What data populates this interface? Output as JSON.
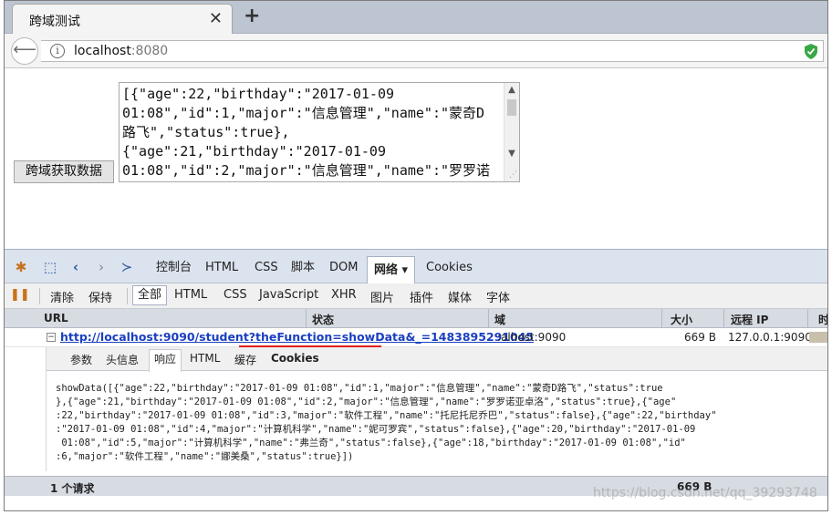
{
  "tab": {
    "title": "跨域测试"
  },
  "address": {
    "host": "localhost",
    "port": ":8080"
  },
  "page": {
    "button_label": "跨域获取数据",
    "result_lines": [
      "[{\"age\":22,\"birthday\":\"2017-01-09",
      "01:08\",\"id\":1,\"major\":\"信息管理\",\"name\":\"蒙奇D",
      "路飞\",\"status\":true},",
      "{\"age\":21,\"birthday\":\"2017-01-09",
      "01:08\",\"id\":2,\"major\":\"信息管理\",\"name\":\"罗罗诺"
    ]
  },
  "firebug": {
    "tabs": [
      "控制台",
      "HTML",
      "CSS",
      "脚本",
      "DOM",
      "网络 ▾",
      "Cookies"
    ],
    "tools": [
      "清除",
      "保持",
      "全部",
      "HTML",
      "CSS",
      "JavaScript",
      "XHR",
      "图片",
      "插件",
      "媒体",
      "字体"
    ],
    "columns": {
      "url": "URL",
      "status": "状态",
      "domain": "域",
      "size": "大小",
      "remote_ip": "远程 IP",
      "timeline": "时"
    },
    "request": {
      "url": "http://localhost:9090/student?theFunction=showData&_=1483895291045",
      "domain": ":alhost:9090",
      "size": "669 B",
      "remote_ip": "127.0.0.1:9090"
    },
    "detail_tabs": [
      "参数",
      "头信息",
      "响应",
      "HTML",
      "缓存",
      "Cookies"
    ],
    "response_lines": [
      "showData([{\"age\":22,\"birthday\":\"2017-01-09 01:08\",\"id\":1,\"major\":\"信息管理\",\"name\":\"蒙奇D路飞\",\"status\":true",
      "},{\"age\":21,\"birthday\":\"2017-01-09 01:08\",\"id\":2,\"major\":\"信息管理\",\"name\":\"罗罗诺亚卓洛\",\"status\":true},{\"age\"",
      ":22,\"birthday\":\"2017-01-09 01:08\",\"id\":3,\"major\":\"软件工程\",\"name\":\"托尼托尼乔巴\",\"status\":false},{\"age\":22,\"birthday\"",
      ":\"2017-01-09 01:08\",\"id\":4,\"major\":\"计算机科学\",\"name\":\"妮可罗宾\",\"status\":false},{\"age\":20,\"birthday\":\"2017-01-09",
      " 01:08\",\"id\":5,\"major\":\"计算机科学\",\"name\":\"弗兰奇\",\"status\":false},{\"age\":18,\"birthday\":\"2017-01-09 01:08\",\"id\"",
      ":6,\"major\":\"软件工程\",\"name\":\"娜美桑\",\"status\":true}])"
    ],
    "status": {
      "count": "1 个请求",
      "size": "669 B"
    }
  },
  "watermark": "https://blog.csdn.net/qq_39293748",
  "colors": {
    "link": "#1a3fbf",
    "underline_mark": "#e02020",
    "panel_bg": "#dbe3ee"
  }
}
